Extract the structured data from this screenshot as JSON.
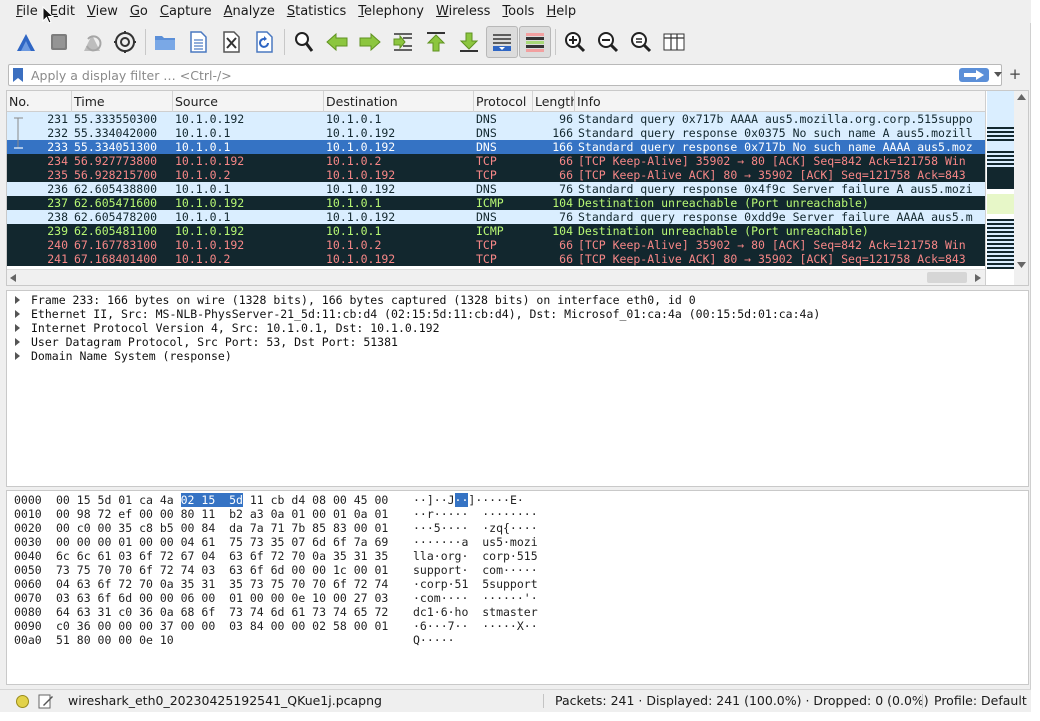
{
  "menubar": {
    "items": [
      {
        "key": "F",
        "rest": "ile"
      },
      {
        "key": "E",
        "rest": "dit"
      },
      {
        "key": "V",
        "rest": "iew"
      },
      {
        "key": "G",
        "rest": "o"
      },
      {
        "key": "C",
        "rest": "apture"
      },
      {
        "key": "A",
        "rest": "nalyze"
      },
      {
        "key": "S",
        "rest": "tatistics"
      },
      {
        "key": "T",
        "rest": "elephony"
      },
      {
        "key": "W",
        "rest": "ireless"
      },
      {
        "key": "T",
        "rest": "ools"
      },
      {
        "key": "H",
        "rest": "elp"
      }
    ]
  },
  "toolbar": {
    "buttons": [
      "shark-fin-start-icon",
      "stop-capture-icon",
      "restart-capture-icon",
      "capture-options-gear-icon",
      "open-folder-icon",
      "save-file-icon",
      "close-file-icon",
      "reload-file-icon",
      "find-packet-icon",
      "go-back-icon",
      "go-forward-icon",
      "go-to-packet-icon",
      "go-first-packet-icon",
      "go-last-packet-icon",
      "autoscroll-icon",
      "colorize-icon",
      "zoom-in-icon",
      "zoom-out-icon",
      "zoom-normal-icon",
      "resize-columns-icon"
    ]
  },
  "filter": {
    "placeholder": "Apply a display filter … <Ctrl-/>",
    "value": ""
  },
  "packet_list": {
    "columns": [
      "No.",
      "Time",
      "Source",
      "Destination",
      "Protocol",
      "Length",
      "Info"
    ],
    "rows": [
      {
        "no": "231",
        "time": "55.333550300",
        "src": "10.1.0.192",
        "dst": "10.1.0.1",
        "proto": "DNS",
        "len": "96",
        "info": "Standard query 0x717b AAAA aus5.mozilla.org.corp.515suppo",
        "style": "dns"
      },
      {
        "no": "232",
        "time": "55.334042000",
        "src": "10.1.0.1",
        "dst": "10.1.0.192",
        "proto": "DNS",
        "len": "166",
        "info": "Standard query response 0x0375 No such name A aus5.mozill",
        "style": "dns"
      },
      {
        "no": "233",
        "time": "55.334051300",
        "src": "10.1.0.1",
        "dst": "10.1.0.192",
        "proto": "DNS",
        "len": "166",
        "info": "Standard query response 0x717b No such name AAAA aus5.moz",
        "style": "selected"
      },
      {
        "no": "234",
        "time": "56.927773800",
        "src": "10.1.0.192",
        "dst": "10.1.0.2",
        "proto": "TCP",
        "len": "66",
        "info": "[TCP Keep-Alive] 35902 → 80 [ACK] Seq=842 Ack=121758 Win",
        "style": "bad"
      },
      {
        "no": "235",
        "time": "56.928215700",
        "src": "10.1.0.2",
        "dst": "10.1.0.192",
        "proto": "TCP",
        "len": "66",
        "info": "[TCP Keep-Alive ACK] 80 → 35902 [ACK] Seq=121758 Ack=843",
        "style": "bad"
      },
      {
        "no": "236",
        "time": "62.605438800",
        "src": "10.1.0.1",
        "dst": "10.1.0.192",
        "proto": "DNS",
        "len": "76",
        "info": "Standard query response 0x4f9c Server failure A aus5.mozi",
        "style": "dns"
      },
      {
        "no": "237",
        "time": "62.605471600",
        "src": "10.1.0.192",
        "dst": "10.1.0.1",
        "proto": "ICMP",
        "len": "104",
        "info": "Destination unreachable (Port unreachable)",
        "style": "icmp"
      },
      {
        "no": "238",
        "time": "62.605478200",
        "src": "10.1.0.1",
        "dst": "10.1.0.192",
        "proto": "DNS",
        "len": "76",
        "info": "Standard query response 0xdd9e Server failure AAAA aus5.m",
        "style": "dns"
      },
      {
        "no": "239",
        "time": "62.605481100",
        "src": "10.1.0.192",
        "dst": "10.1.0.1",
        "proto": "ICMP",
        "len": "104",
        "info": "Destination unreachable (Port unreachable)",
        "style": "icmp"
      },
      {
        "no": "240",
        "time": "67.167783100",
        "src": "10.1.0.192",
        "dst": "10.1.0.2",
        "proto": "TCP",
        "len": "66",
        "info": "[TCP Keep-Alive] 35902 → 80 [ACK] Seq=842 Ack=121758 Win",
        "style": "bad"
      },
      {
        "no": "241",
        "time": "67.168401400",
        "src": "10.1.0.2",
        "dst": "10.1.0.192",
        "proto": "TCP",
        "len": "66",
        "info": "[TCP Keep-Alive ACK] 80 → 35902 [ACK] Seq=121758 Ack=843",
        "style": "bad"
      }
    ]
  },
  "details": {
    "items": [
      "Frame 233: 166 bytes on wire (1328 bits), 166 bytes captured (1328 bits) on interface eth0, id 0",
      "Ethernet II, Src: MS-NLB-PhysServer-21_5d:11:cb:d4 (02:15:5d:11:cb:d4), Dst: Microsof_01:ca:4a (00:15:5d:01:ca:4a)",
      "Internet Protocol Version 4, Src: 10.1.0.1, Dst: 10.1.0.192",
      "User Datagram Protocol, Src Port: 53, Dst Port: 51381",
      "Domain Name System (response)"
    ]
  },
  "bytes": {
    "rows": [
      {
        "offset": "0000",
        "pre": "00 15 5d 01 ca 4a ",
        "sel": "02 15  5d",
        "post": " 11 cb d4 08 00 45 00",
        "apre": "··]··J",
        "asel": "··",
        "apost": "]·····E·"
      },
      {
        "offset": "0010",
        "pre": "00 98 72 ef 00 00 80 11  b2 a3 0a 01 00 01 0a 01",
        "sel": "",
        "post": "",
        "apre": "··r·····  ········",
        "asel": "",
        "apost": ""
      },
      {
        "offset": "0020",
        "pre": "00 c0 00 35 c8 b5 00 84  da 7a 71 7b 85 83 00 01",
        "sel": "",
        "post": "",
        "apre": "···5····  ·zq{····",
        "asel": "",
        "apost": ""
      },
      {
        "offset": "0030",
        "pre": "00 00 00 01 00 00 04 61  75 73 35 07 6d 6f 7a 69",
        "sel": "",
        "post": "",
        "apre": "·······a  us5·mozi",
        "asel": "",
        "apost": ""
      },
      {
        "offset": "0040",
        "pre": "6c 6c 61 03 6f 72 67 04  63 6f 72 70 0a 35 31 35",
        "sel": "",
        "post": "",
        "apre": "lla·org·  corp·515",
        "asel": "",
        "apost": ""
      },
      {
        "offset": "0050",
        "pre": "73 75 70 70 6f 72 74 03  63 6f 6d 00 00 1c 00 01",
        "sel": "",
        "post": "",
        "apre": "support·  com·····",
        "asel": "",
        "apost": ""
      },
      {
        "offset": "0060",
        "pre": "04 63 6f 72 70 0a 35 31  35 73 75 70 70 6f 72 74",
        "sel": "",
        "post": "",
        "apre": "·corp·51  5support",
        "asel": "",
        "apost": ""
      },
      {
        "offset": "0070",
        "pre": "03 63 6f 6d 00 00 06 00  01 00 00 0e 10 00 27 03",
        "sel": "",
        "post": "",
        "apre": "·com····  ······'·",
        "asel": "",
        "apost": ""
      },
      {
        "offset": "0080",
        "pre": "64 63 31 c0 36 0a 68 6f  73 74 6d 61 73 74 65 72",
        "sel": "",
        "post": "",
        "apre": "dc1·6·ho  stmaster",
        "asel": "",
        "apost": ""
      },
      {
        "offset": "0090",
        "pre": "c0 36 00 00 00 37 00 00  03 84 00 00 02 58 00 01",
        "sel": "",
        "post": "",
        "apre": "·6···7··  ·····X··",
        "asel": "",
        "apost": ""
      },
      {
        "offset": "00a0",
        "pre": "51 80 00 00 0e 10",
        "sel": "",
        "post": "",
        "apre": "Q·····",
        "asel": "",
        "apost": ""
      }
    ]
  },
  "statusbar": {
    "file": "wireshark_eth0_20230425192541_QKue1j.pcapng",
    "packets": "Packets: 241 · Displayed: 241 (100.0%) · Dropped: 0 (0.0%)",
    "profile": "Profile: Default"
  },
  "colors": {
    "dns_bg": "#daeeff",
    "dns_fg": "#12272e",
    "selected_bg": "#3573c4",
    "selected_fg": "#ffffff",
    "bad_bg": "#12272e",
    "bad_fg": "#f78787",
    "icmp_bg": "#12272e",
    "icmp_fg": "#b7f774"
  }
}
